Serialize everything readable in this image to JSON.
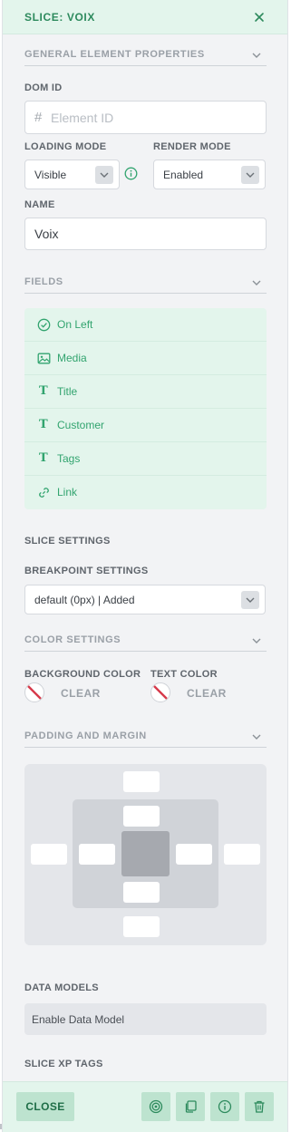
{
  "header": {
    "title": "SLICE: VOIX",
    "close_icon": "close-icon"
  },
  "general": {
    "section_title": "GENERAL ELEMENT PROPERTIES",
    "dom_id": {
      "label": "DOM ID",
      "prefix": "#",
      "placeholder": "Element ID",
      "value": ""
    },
    "loading_mode": {
      "label": "LOADING MODE",
      "value": "Visible",
      "info_icon": "info-icon"
    },
    "render_mode": {
      "label": "RENDER MODE",
      "value": "Enabled"
    },
    "name": {
      "label": "NAME",
      "value": "Voix"
    }
  },
  "fields": {
    "section_title": "FIELDS",
    "items": [
      {
        "label": "On Left",
        "icon": "check-circle-icon"
      },
      {
        "label": "Media",
        "icon": "image-icon"
      },
      {
        "label": "Title",
        "icon": "text-icon"
      },
      {
        "label": "Customer",
        "icon": "text-icon"
      },
      {
        "label": "Tags",
        "icon": "text-icon"
      },
      {
        "label": "Link",
        "icon": "link-icon"
      }
    ]
  },
  "slice_settings": {
    "title": "SLICE SETTINGS",
    "breakpoint_label": "BREAKPOINT SETTINGS",
    "breakpoint_value": "default (0px) | Added"
  },
  "color_settings": {
    "section_title": "COLOR SETTINGS",
    "background": {
      "label": "BACKGROUND COLOR",
      "clear": "CLEAR"
    },
    "text": {
      "label": "TEXT COLOR",
      "clear": "CLEAR"
    }
  },
  "padding": {
    "section_title": "PADDING AND MARGIN"
  },
  "data_models": {
    "title": "DATA MODELS",
    "button": "Enable Data Model"
  },
  "xp_tags": {
    "title": "SLICE XP TAGS"
  },
  "footer": {
    "close_label": "CLOSE",
    "icons": [
      "target-icon",
      "copy-icon",
      "info-icon",
      "trash-icon"
    ]
  },
  "colors": {
    "accent": "#32a46f",
    "accent_bg": "#e3f5ec",
    "button_bg": "#bde3cf",
    "clear_slash": "#d6394a"
  }
}
